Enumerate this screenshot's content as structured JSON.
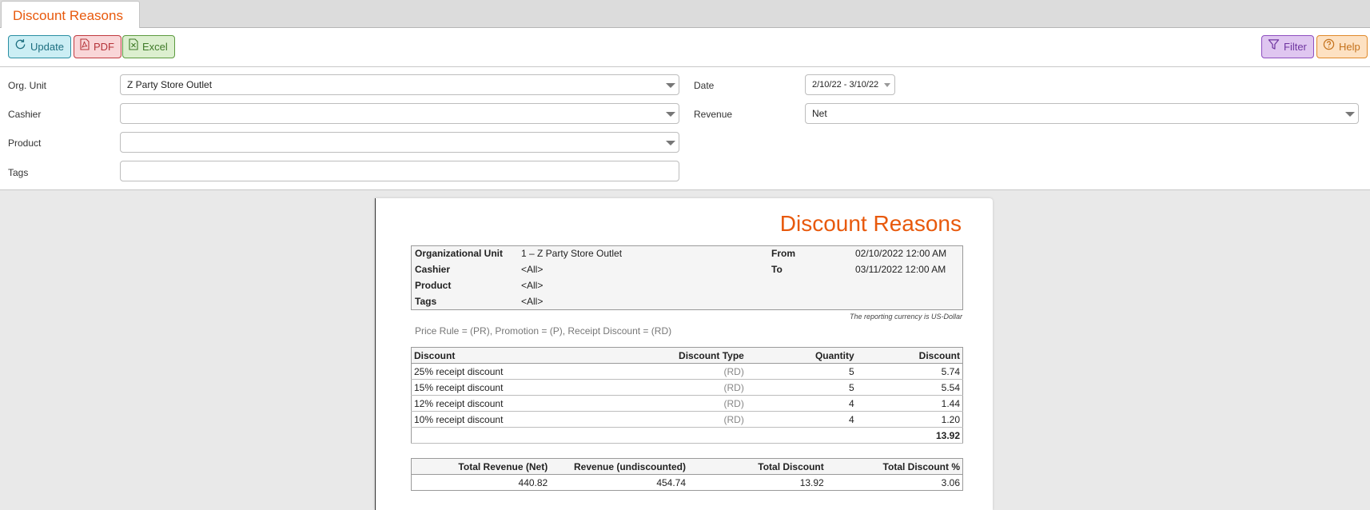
{
  "tab": {
    "title": "Discount Reasons"
  },
  "toolbar": {
    "update": "Update",
    "pdf": "PDF",
    "excel": "Excel",
    "filter": "Filter",
    "help": "Help"
  },
  "filters": {
    "org_unit_label": "Org. Unit",
    "org_unit_value": "Z Party Store Outlet",
    "cashier_label": "Cashier",
    "cashier_value": "",
    "product_label": "Product",
    "product_value": "",
    "tags_label": "Tags",
    "tags_value": "",
    "date_label": "Date",
    "date_value": "2/10/22 - 3/10/22",
    "revenue_label": "Revenue",
    "revenue_value": "Net"
  },
  "report": {
    "title": "Discount Reasons",
    "info": {
      "org_unit_key": "Organizational Unit",
      "org_unit_val": "1 – Z Party Store Outlet",
      "cashier_key": "Cashier",
      "cashier_val": "<All>",
      "product_key": "Product",
      "product_val": "<All>",
      "tags_key": "Tags",
      "tags_val": "<All>",
      "from_key": "From",
      "from_val": "02/10/2022 12:00 AM",
      "to_key": "To",
      "to_val": "03/11/2022 12:00 AM"
    },
    "currency_note": "The reporting currency is US-Dollar",
    "legend": "Price Rule = (PR), Promotion = (P), Receipt Discount = (RD)",
    "table_headers": [
      "Discount",
      "Discount Type",
      "Quantity",
      "Discount"
    ],
    "rows": [
      {
        "discount": "25% receipt discount",
        "type": "(RD)",
        "qty": "5",
        "amount": "5.74"
      },
      {
        "discount": "15% receipt discount",
        "type": "(RD)",
        "qty": "5",
        "amount": "5.54"
      },
      {
        "discount": "12% receipt discount",
        "type": "(RD)",
        "qty": "4",
        "amount": "1.44"
      },
      {
        "discount": "10% receipt discount",
        "type": "(RD)",
        "qty": "4",
        "amount": "1.20"
      }
    ],
    "total": "13.92",
    "summary_headers": [
      "Total Revenue (Net)",
      "Revenue (undiscounted)",
      "Total Discount",
      "Total Discount %"
    ],
    "summary_values": [
      "440.82",
      "454.74",
      "13.92",
      "3.06"
    ]
  },
  "colors": {
    "accent": "#e8590c",
    "update": "#cbeef4",
    "pdf": "#f9d6d8",
    "excel": "#dcefcf",
    "filter": "#dfc6f0",
    "help": "#fde1c2"
  },
  "icons": {
    "update": "refresh-icon",
    "pdf": "pdf-file-icon",
    "excel": "excel-file-icon",
    "filter": "funnel-icon",
    "help": "help-circle-icon"
  }
}
